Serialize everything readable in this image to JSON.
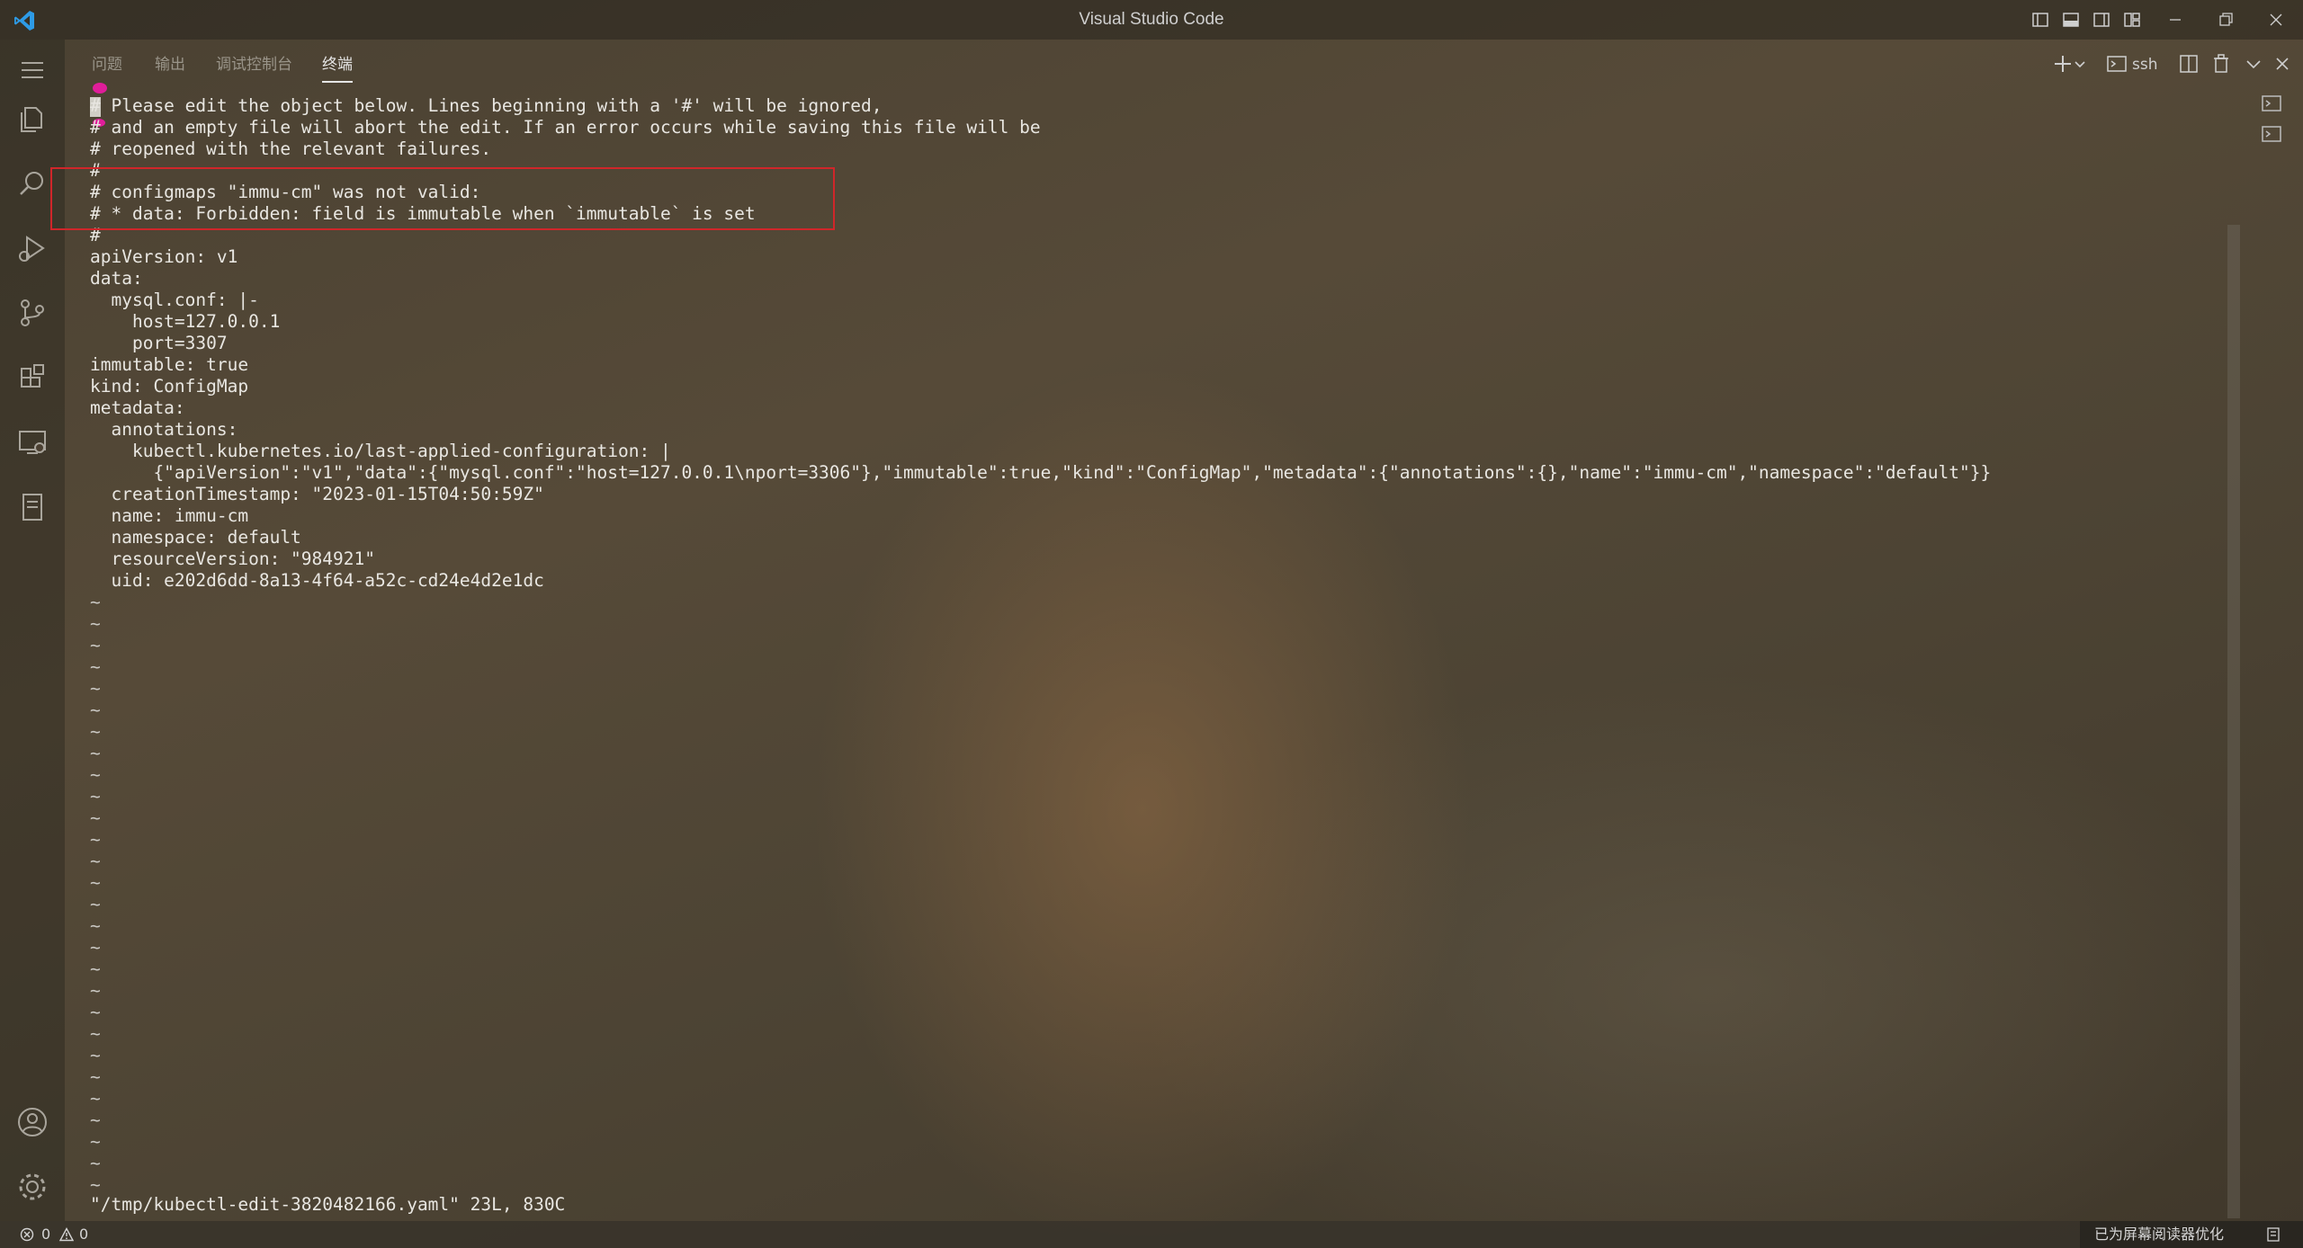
{
  "window": {
    "title": "Visual Studio Code"
  },
  "panel": {
    "tabs": [
      {
        "label": "问题",
        "active": false
      },
      {
        "label": "输出",
        "active": false
      },
      {
        "label": "调试控制台",
        "active": false
      },
      {
        "label": "终端",
        "active": true
      }
    ],
    "terminal_name": "ssh"
  },
  "terminal": {
    "lines": [
      "# Please edit the object below. Lines beginning with a '#' will be ignored,",
      "# and an empty file will abort the edit. If an error occurs while saving this file will be",
      "# reopened with the relevant failures.",
      "#",
      "# configmaps \"immu-cm\" was not valid:",
      "# * data: Forbidden: field is immutable when `immutable` is set",
      "#",
      "apiVersion: v1",
      "data:",
      "  mysql.conf: |-",
      "    host=127.0.0.1",
      "    port=3307",
      "immutable: true",
      "kind: ConfigMap",
      "metadata:",
      "  annotations:",
      "    kubectl.kubernetes.io/last-applied-configuration: |",
      "      {\"apiVersion\":\"v1\",\"data\":{\"mysql.conf\":\"host=127.0.0.1\\nport=3306\"},\"immutable\":true,\"kind\":\"ConfigMap\",\"metadata\":{\"annotations\":{},\"name\":\"immu-cm\",\"namespace\":\"default\"}}",
      "  creationTimestamp: \"2023-01-15T04:50:59Z\"",
      "  name: immu-cm",
      "  namespace: default",
      "  resourceVersion: \"984921\"",
      "  uid: e202d6dd-8a13-4f64-a52c-cd24e4d2e1dc"
    ],
    "tilde_count": 28,
    "tilde_char": "~",
    "status_line": "\"/tmp/kubectl-edit-3820482166.yaml\" 23L, 830C",
    "highlight_color": "#d0262a"
  },
  "statusbar": {
    "errors": "0",
    "warnings": "0",
    "accessibility": "已为屏幕阅读器优化"
  }
}
